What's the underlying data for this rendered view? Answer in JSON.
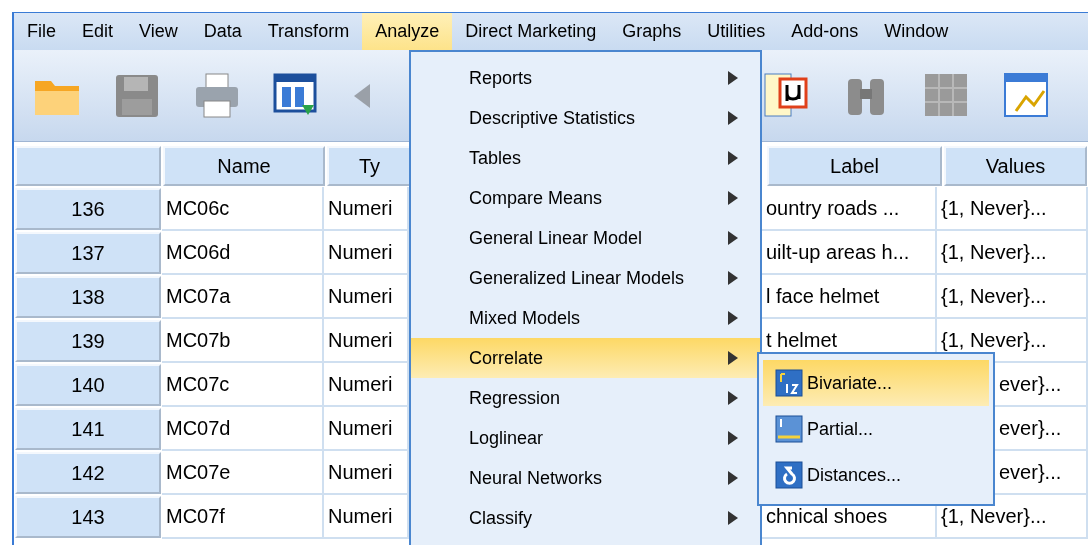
{
  "menu_bar": [
    {
      "label": "File",
      "selected": false
    },
    {
      "label": "Edit",
      "selected": false
    },
    {
      "label": "View",
      "selected": false
    },
    {
      "label": "Data",
      "selected": false
    },
    {
      "label": "Transform",
      "selected": false
    },
    {
      "label": "Analyze",
      "selected": true
    },
    {
      "label": "Direct Marketing",
      "selected": false
    },
    {
      "label": "Graphs",
      "selected": false
    },
    {
      "label": "Utilities",
      "selected": false
    },
    {
      "label": "Add-ons",
      "selected": false
    },
    {
      "label": "Window",
      "selected": false
    }
  ],
  "toolbar": [
    {
      "kind": "folder"
    },
    {
      "kind": "save"
    },
    {
      "kind": "print"
    },
    {
      "kind": "dataview"
    },
    {
      "kind": "undo"
    },
    {
      "kind": "gap"
    },
    {
      "kind": "variables"
    },
    {
      "kind": "find"
    },
    {
      "kind": "grid"
    },
    {
      "kind": "chart"
    }
  ],
  "grid": {
    "columns": [
      "Name",
      "Ty",
      "Label",
      "Values"
    ],
    "rows": [
      {
        "number": "136",
        "name": "MC06c",
        "type": "Numeri",
        "label": "ountry roads ...",
        "values": "{1, Never}...",
        "covered": false
      },
      {
        "number": "137",
        "name": "MC06d",
        "type": "Numeri",
        "label": "uilt-up areas h...",
        "values": "{1, Never}...",
        "covered": false
      },
      {
        "number": "138",
        "name": "MC07a",
        "type": "Numeri",
        "label": "l face helmet",
        "values": "{1, Never}...",
        "covered": false
      },
      {
        "number": "139",
        "name": "MC07b",
        "type": "Numeri",
        "label": "t helmet",
        "values": "{1, Never}...",
        "covered": false
      },
      {
        "number": "140",
        "name": "MC07c",
        "type": "Numeri",
        "values": "ever}...",
        "covered": true
      },
      {
        "number": "141",
        "name": "MC07d",
        "type": "Numeri",
        "values": "ever}...",
        "covered": true
      },
      {
        "number": "142",
        "name": "MC07e",
        "type": "Numeri",
        "values": "ever}...",
        "covered": true
      },
      {
        "number": "143",
        "name": "MC07f",
        "type": "Numeri",
        "label": "chnical shoes",
        "values": "{1, Never}...",
        "covered": false
      }
    ]
  },
  "analyze_menu": [
    {
      "label": "Reports",
      "selected": false
    },
    {
      "label": "Descriptive Statistics",
      "selected": false
    },
    {
      "label": "Tables",
      "selected": false
    },
    {
      "label": "Compare Means",
      "selected": false
    },
    {
      "label": "General Linear Model",
      "selected": false
    },
    {
      "label": "Generalized Linear Models",
      "selected": false
    },
    {
      "label": "Mixed Models",
      "selected": false
    },
    {
      "label": "Correlate",
      "selected": true
    },
    {
      "label": "Regression",
      "selected": false
    },
    {
      "label": "Loglinear",
      "selected": false
    },
    {
      "label": "Neural Networks",
      "selected": false
    },
    {
      "label": "Classify",
      "selected": false
    }
  ],
  "correlate_submenu": [
    {
      "label": "Bivariate...",
      "kind": "bivariate",
      "selected": true
    },
    {
      "label": "Partial...",
      "kind": "partial",
      "selected": false
    },
    {
      "label": "Distances...",
      "kind": "distances",
      "selected": false
    }
  ]
}
